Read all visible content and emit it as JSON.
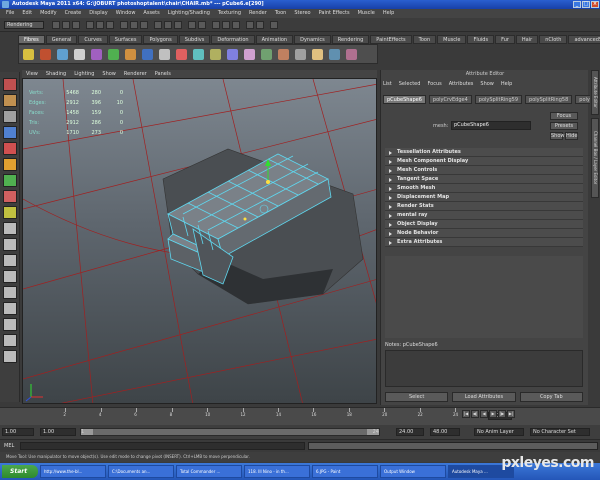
{
  "window": {
    "title": "Autodesk Maya 2011 x64: G:\\JOBURT photoshoptalent\\chair\\CHAIR.mb* --- pCube6.e[290]"
  },
  "menubar": [
    "File",
    "Edit",
    "Modify",
    "Create",
    "Display",
    "Window",
    "Assets",
    "Lighting/Shading",
    "Texturing",
    "Render",
    "Toon",
    "Stereo",
    "Paint Effects",
    "Muscle",
    "Help"
  ],
  "status_line": {
    "mode": "Rendering"
  },
  "shelf_tabs": [
    {
      "label": "Fibres",
      "active": true
    },
    {
      "label": "General",
      "active": false
    },
    {
      "label": "Curves",
      "active": false
    },
    {
      "label": "Surfaces",
      "active": false
    },
    {
      "label": "Polygons",
      "active": false
    },
    {
      "label": "Subdivs",
      "active": false
    },
    {
      "label": "Deformation",
      "active": false
    },
    {
      "label": "Animation",
      "active": false
    },
    {
      "label": "Dynamics",
      "active": false
    },
    {
      "label": "Rendering",
      "active": false
    },
    {
      "label": "PaintEffects",
      "active": false
    },
    {
      "label": "Toon",
      "active": false
    },
    {
      "label": "Muscle",
      "active": false
    },
    {
      "label": "Fluids",
      "active": false
    },
    {
      "label": "Fur",
      "active": false
    },
    {
      "label": "Hair",
      "active": false
    },
    {
      "label": "nCloth",
      "active": false
    },
    {
      "label": "advancedSkeleton",
      "active": false
    }
  ],
  "viewport": {
    "menu": [
      "View",
      "Shading",
      "Lighting",
      "Show",
      "Renderer",
      "Panels"
    ],
    "hud": [
      {
        "label": "Verts:",
        "a": "5468",
        "b": "280",
        "c": "0"
      },
      {
        "label": "Edges:",
        "a": "2912",
        "b": "396",
        "c": "10"
      },
      {
        "label": "Faces:",
        "a": "1458",
        "b": "159",
        "c": "0"
      },
      {
        "label": "Tris:",
        "a": "2912",
        "b": "286",
        "c": "0"
      },
      {
        "label": "UVs:",
        "a": "1710",
        "b": "273",
        "c": "0"
      }
    ]
  },
  "attribute_editor": {
    "title": "Attribute Editor",
    "menu": [
      "List",
      "Selected",
      "Focus",
      "Attributes",
      "Show",
      "Help"
    ],
    "tabs": [
      {
        "label": "pCubeShape6",
        "active": true
      },
      {
        "label": "polyCrvEdge4",
        "active": false
      },
      {
        "label": "polySplitRing59",
        "active": false
      },
      {
        "label": "polySplitRing58",
        "active": false
      },
      {
        "label": "poly",
        "active": false
      }
    ],
    "mesh_label": "mesh:",
    "mesh_value": "pCubeShape6",
    "focus_label": "Focus",
    "presets_label": "Presets",
    "show_label": "Show",
    "hide_label": "Hide",
    "sections": [
      "Tessellation Attributes",
      "Mesh Component Display",
      "Mesh Controls",
      "Tangent Space",
      "Smooth Mesh",
      "Displacement Map",
      "Render Stats",
      "mental ray",
      "Object Display",
      "Node Behavior",
      "Extra Attributes"
    ],
    "notes_label": "Notes: pCubeShape6",
    "buttons": [
      "Select",
      "Load Attributes",
      "Copy Tab"
    ]
  },
  "side_tabs": [
    "Attribute Editor",
    "Channel Box / Layer Editor"
  ],
  "time_slider": {
    "ticks": [
      "2",
      "4",
      "6",
      "8",
      "10",
      "12",
      "14",
      "16",
      "18",
      "20",
      "22",
      "24"
    ],
    "current_time": "1.00"
  },
  "range_slider": {
    "start": "1.00",
    "inner_start": "1.00",
    "handle_start": "1",
    "handle_end": "24",
    "end_inner": "24.00",
    "end": "48.00",
    "anim_layer": "No Anim Layer",
    "char_set": "No Character Set"
  },
  "command_line": {
    "label": "MEL"
  },
  "help_line": "Move Tool: Use manipulator to move object(s). Use edit mode to change pivot (INSERT). Ctrl+LMB to move perpendicular.",
  "taskbar": {
    "start": "Start",
    "tasks": [
      {
        "label": "http://www.the-bl...",
        "active": false
      },
      {
        "label": "C:\\Documents an...",
        "active": false
      },
      {
        "label": "Total Commander ...",
        "active": false
      },
      {
        "label": "118. Ill Nino - in th...",
        "active": false
      },
      {
        "label": "6.JPG - Paint",
        "active": false
      },
      {
        "label": "Output Window",
        "active": false
      },
      {
        "label": "Autodesk Maya ...",
        "active": true
      }
    ]
  },
  "watermark": "pxleyes.com"
}
